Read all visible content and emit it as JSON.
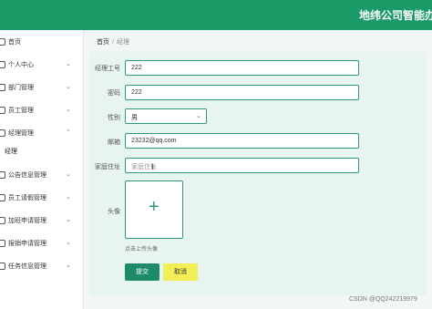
{
  "header": {
    "title": "地纬公司智能办公"
  },
  "sidebar": {
    "items": [
      {
        "label": "首页",
        "icon": "home-icon"
      },
      {
        "label": "个人中心",
        "icon": "user-icon"
      },
      {
        "label": "部门管理",
        "icon": "grid-icon"
      },
      {
        "label": "员工管理",
        "icon": "doc-icon"
      },
      {
        "label": "经理管理",
        "icon": "doc-icon"
      },
      {
        "label": "公告信息管理",
        "icon": "bell-icon"
      },
      {
        "label": "员工请假管理",
        "icon": "calendar-icon"
      },
      {
        "label": "加班申请管理",
        "icon": "clock-icon"
      },
      {
        "label": "报销申请管理",
        "icon": "wallet-icon"
      },
      {
        "label": "任务信息管理",
        "icon": "task-icon"
      }
    ],
    "sub_item": "经理"
  },
  "breadcrumb": {
    "home": "首页",
    "separator": "/",
    "current": "经理"
  },
  "form": {
    "id_label": "经理工号",
    "id_value": "222",
    "password_label": "密码",
    "password_value": "222",
    "gender_label": "性别",
    "gender_value": "男",
    "email_label": "邮箱",
    "email_value": "23232@qq.com",
    "address_label": "家庭住址",
    "address_placeholder": "家庭住址",
    "avatar_label": "头像",
    "avatar_hint": "点击上传头像",
    "submit_label": "提交",
    "cancel_label": "取消"
  },
  "watermark": "CSDN @QQ242219979",
  "colors": {
    "primary": "#1a9a67",
    "cancel": "#f2ee55",
    "panel": "#e8f4ef"
  }
}
